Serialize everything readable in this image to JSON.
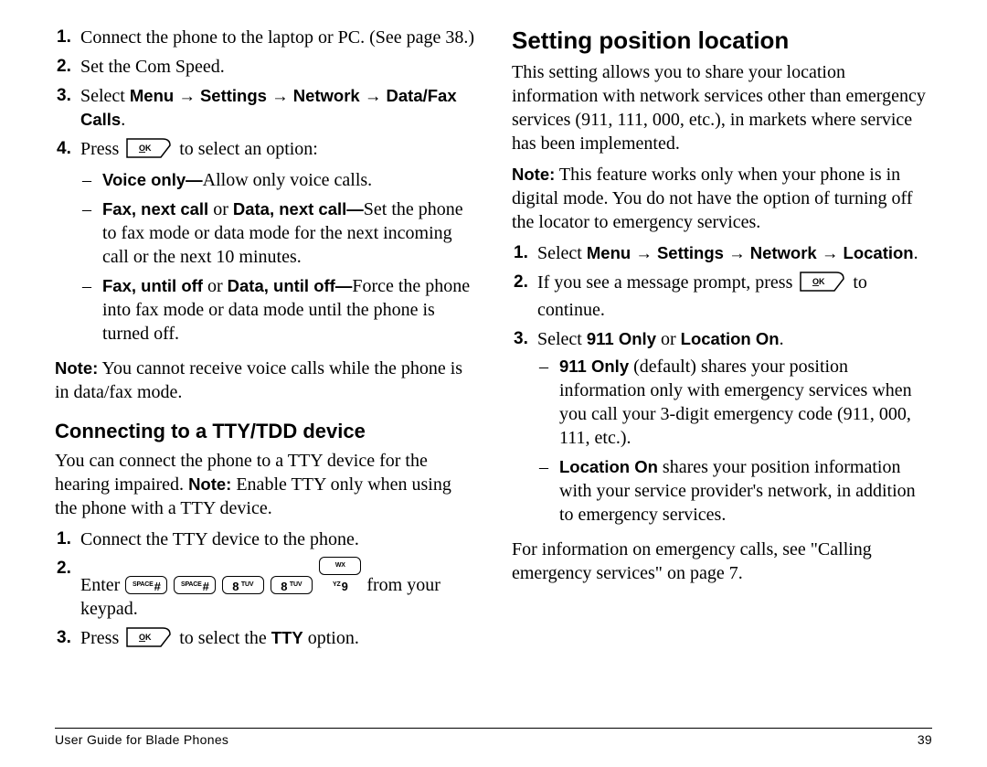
{
  "left": {
    "steps_a": {
      "s1": "Connect the phone to the laptop or PC. (See page 38.)",
      "s2": "Set the Com Speed.",
      "s3_pre": "Select ",
      "s3_menu": "Menu",
      "s3_settings": "Settings",
      "s3_network": "Network",
      "s3_dfc": "Data/Fax Calls",
      "s3_post": ".",
      "s4_pre": "Press ",
      "s4_post": " to select an option:",
      "opt1_b": "Voice only—",
      "opt1_t": "Allow only voice calls.",
      "opt2_b": "Fax, next call",
      "opt2_or": " or ",
      "opt2_b2": "Data, next call—",
      "opt2_t": "Set the phone to fax mode or data mode for the next incoming call or the next 10 minutes.",
      "opt3_b": "Fax, until off",
      "opt3_or": " or ",
      "opt3_b2": "Data, until off—",
      "opt3_t": "Force the phone into fax mode or data mode until the phone is turned off."
    },
    "note_a_lbl": "Note:",
    "note_a": "  You cannot receive voice calls while the phone is in data/fax mode.",
    "h2": "Connecting to a TTY/TDD device",
    "tty_intro_a": "You can connect the phone to a TTY device for the hearing impaired. ",
    "tty_note_lbl": "Note:",
    "tty_intro_b": " Enable TTY only when using the phone with a TTY device.",
    "steps_b": {
      "s1": "Connect the TTY device to the phone.",
      "s2_pre": "Enter ",
      "s2_post": " from your keypad.",
      "s3_pre": "Press ",
      "s3_mid": " to select the ",
      "s3_tty": "TTY",
      "s3_post": " option."
    }
  },
  "right": {
    "h1": "Setting position location",
    "p1": "This setting allows you to share your location information with network services other than emergency services (911, 111, 000, etc.), in markets where service has been implemented.",
    "note_lbl": "Note:",
    "note": "  This feature works only when your phone is in digital mode. You do not have the option of turning off the locator to emergency services.",
    "steps": {
      "s1_pre": "Select ",
      "s1_menu": "Menu",
      "s1_settings": "Settings",
      "s1_network": "Network",
      "s1_location": "Location",
      "s1_post": ".",
      "s2_pre": "If you see a message prompt, press ",
      "s2_post": " to continue.",
      "s3_pre": "Select ",
      "s3_a": "911 Only",
      "s3_or": " or ",
      "s3_b": "Location On",
      "s3_post": ".",
      "opt1_b": "911 Only",
      "opt1_t": " (default) shares your position information only with emergency services when you call your 3-digit emergency code (911, 000, 111, etc.).",
      "opt2_b": "Location On",
      "opt2_t": " shares your position information with your service provider's network, in addition to emergency services."
    },
    "p2": "For information on emergency calls, see \"Calling emergency services\" on page 7."
  },
  "footer": {
    "left": "User Guide for Blade Phones",
    "right": "39"
  },
  "arrow": " → "
}
